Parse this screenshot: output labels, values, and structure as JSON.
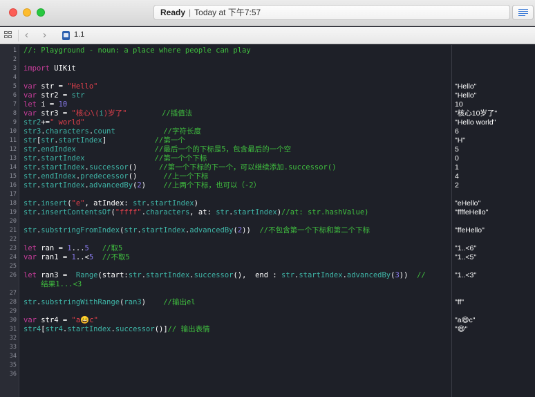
{
  "window": {
    "status": "Ready",
    "status_time": "Today at 下午7:57",
    "file_name": "1.1"
  },
  "icons": [
    "close-button",
    "minimize-button",
    "zoom-button",
    "editor-toggle-icon",
    "grid-icon",
    "back-chevron-icon",
    "forward-chevron-icon",
    "swift-file-icon"
  ],
  "colors": {
    "keyword": "#c83d9b",
    "string": "#e4404c",
    "number": "#8b7cf0",
    "comment": "#40bf3f",
    "api": "#3fb5a7",
    "background": "#1e2028"
  },
  "lines": [
    {
      "n": "1",
      "t": [
        {
          "c": "cm",
          "v": "//: Playground - noun: a place where people can play"
        }
      ],
      "r": ""
    },
    {
      "n": "2",
      "t": [],
      "r": ""
    },
    {
      "n": "3",
      "t": [
        {
          "c": "kw",
          "v": "import"
        },
        {
          "c": "pl",
          "v": " UIKit"
        }
      ],
      "r": ""
    },
    {
      "n": "4",
      "t": [],
      "r": ""
    },
    {
      "n": "5",
      "t": [
        {
          "c": "kw",
          "v": "var"
        },
        {
          "c": "pl",
          "v": " str = "
        },
        {
          "c": "str",
          "v": "\"Hello\""
        }
      ],
      "r": "\"Hello\""
    },
    {
      "n": "6",
      "t": [
        {
          "c": "kw",
          "v": "var"
        },
        {
          "c": "pl",
          "v": " str2 = "
        },
        {
          "c": "ap",
          "v": "str"
        }
      ],
      "r": "\"Hello\""
    },
    {
      "n": "7",
      "t": [
        {
          "c": "kw",
          "v": "let"
        },
        {
          "c": "pl",
          "v": " i = "
        },
        {
          "c": "num",
          "v": "10"
        }
      ],
      "r": "10"
    },
    {
      "n": "8",
      "t": [
        {
          "c": "kw",
          "v": "var"
        },
        {
          "c": "pl",
          "v": " str3 = "
        },
        {
          "c": "str",
          "v": "\"核心\\("
        },
        {
          "c": "ap",
          "v": "i"
        },
        {
          "c": "str",
          "v": ")岁了\""
        },
        {
          "c": "pl",
          "v": "        "
        },
        {
          "c": "cm",
          "v": "//插值法"
        }
      ],
      "r": "\"核心10岁了\""
    },
    {
      "n": "9",
      "t": [
        {
          "c": "ap",
          "v": "str2"
        },
        {
          "c": "pl",
          "v": "+="
        },
        {
          "c": "str",
          "v": "\" world\""
        }
      ],
      "r": "\"Hello world\""
    },
    {
      "n": "10",
      "t": [
        {
          "c": "ap",
          "v": "str3"
        },
        {
          "c": "pl",
          "v": "."
        },
        {
          "c": "ap",
          "v": "characters"
        },
        {
          "c": "pl",
          "v": "."
        },
        {
          "c": "ap",
          "v": "count"
        },
        {
          "c": "pl",
          "v": "           "
        },
        {
          "c": "cm",
          "v": "//字符长度"
        }
      ],
      "r": "6"
    },
    {
      "n": "11",
      "t": [
        {
          "c": "ap",
          "v": "str"
        },
        {
          "c": "pl",
          "v": "["
        },
        {
          "c": "ap",
          "v": "str"
        },
        {
          "c": "pl",
          "v": "."
        },
        {
          "c": "ap",
          "v": "startIndex"
        },
        {
          "c": "pl",
          "v": "]           "
        },
        {
          "c": "cm",
          "v": "//第一个"
        }
      ],
      "r": "\"H\""
    },
    {
      "n": "12",
      "t": [
        {
          "c": "ap",
          "v": "str"
        },
        {
          "c": "pl",
          "v": "."
        },
        {
          "c": "ap",
          "v": "endIndex"
        },
        {
          "c": "pl",
          "v": "                  "
        },
        {
          "c": "cm",
          "v": "//最后一个的下标是5，包含最后的一个空"
        }
      ],
      "r": "5"
    },
    {
      "n": "13",
      "t": [
        {
          "c": "ap",
          "v": "str"
        },
        {
          "c": "pl",
          "v": "."
        },
        {
          "c": "ap",
          "v": "startIndex"
        },
        {
          "c": "pl",
          "v": "                "
        },
        {
          "c": "cm",
          "v": "//第一个个下标"
        }
      ],
      "r": "0"
    },
    {
      "n": "14",
      "t": [
        {
          "c": "ap",
          "v": "str"
        },
        {
          "c": "pl",
          "v": "."
        },
        {
          "c": "ap",
          "v": "startIndex"
        },
        {
          "c": "pl",
          "v": "."
        },
        {
          "c": "ap",
          "v": "successor"
        },
        {
          "c": "pl",
          "v": "()     "
        },
        {
          "c": "cm",
          "v": "//第一个下标的下一个，可以继续添加.successor()"
        }
      ],
      "r": "1"
    },
    {
      "n": "15",
      "t": [
        {
          "c": "ap",
          "v": "str"
        },
        {
          "c": "pl",
          "v": "."
        },
        {
          "c": "ap",
          "v": "endIndex"
        },
        {
          "c": "pl",
          "v": "."
        },
        {
          "c": "ap",
          "v": "predecessor"
        },
        {
          "c": "pl",
          "v": "()      "
        },
        {
          "c": "cm",
          "v": "//上一个下标"
        }
      ],
      "r": "4"
    },
    {
      "n": "16",
      "t": [
        {
          "c": "ap",
          "v": "str"
        },
        {
          "c": "pl",
          "v": "."
        },
        {
          "c": "ap",
          "v": "startIndex"
        },
        {
          "c": "pl",
          "v": "."
        },
        {
          "c": "ap",
          "v": "advancedBy"
        },
        {
          "c": "pl",
          "v": "("
        },
        {
          "c": "num",
          "v": "2"
        },
        {
          "c": "pl",
          "v": ")    "
        },
        {
          "c": "cm",
          "v": "//上两个下标，也可以（-2）"
        }
      ],
      "r": "2"
    },
    {
      "n": "17",
      "t": [],
      "r": ""
    },
    {
      "n": "18",
      "t": [
        {
          "c": "ap",
          "v": "str"
        },
        {
          "c": "pl",
          "v": "."
        },
        {
          "c": "ap",
          "v": "insert"
        },
        {
          "c": "pl",
          "v": "("
        },
        {
          "c": "str",
          "v": "\"e\""
        },
        {
          "c": "pl",
          "v": ", atIndex: "
        },
        {
          "c": "ap",
          "v": "str"
        },
        {
          "c": "pl",
          "v": "."
        },
        {
          "c": "ap",
          "v": "startIndex"
        },
        {
          "c": "pl",
          "v": ")"
        }
      ],
      "r": "\"eHello\""
    },
    {
      "n": "19",
      "t": [
        {
          "c": "ap",
          "v": "str"
        },
        {
          "c": "pl",
          "v": "."
        },
        {
          "c": "ap",
          "v": "insertContentsOf"
        },
        {
          "c": "pl",
          "v": "("
        },
        {
          "c": "str",
          "v": "\"ffff\""
        },
        {
          "c": "pl",
          "v": "."
        },
        {
          "c": "ap",
          "v": "characters"
        },
        {
          "c": "pl",
          "v": ", at: "
        },
        {
          "c": "ap",
          "v": "str"
        },
        {
          "c": "pl",
          "v": "."
        },
        {
          "c": "ap",
          "v": "startIndex"
        },
        {
          "c": "pl",
          "v": ")"
        },
        {
          "c": "cm",
          "v": "//at: str.hashValue)"
        }
      ],
      "r": "\"ffffeHello\""
    },
    {
      "n": "20",
      "t": [],
      "r": ""
    },
    {
      "n": "21",
      "t": [
        {
          "c": "ap",
          "v": "str"
        },
        {
          "c": "pl",
          "v": "."
        },
        {
          "c": "ap",
          "v": "substringFromIndex"
        },
        {
          "c": "pl",
          "v": "("
        },
        {
          "c": "ap",
          "v": "str"
        },
        {
          "c": "pl",
          "v": "."
        },
        {
          "c": "ap",
          "v": "startIndex"
        },
        {
          "c": "pl",
          "v": "."
        },
        {
          "c": "ap",
          "v": "advancedBy"
        },
        {
          "c": "pl",
          "v": "("
        },
        {
          "c": "num",
          "v": "2"
        },
        {
          "c": "pl",
          "v": "))  "
        },
        {
          "c": "cm",
          "v": "//不包含第一个下标和第二个下标"
        }
      ],
      "r": "\"ffeHello\""
    },
    {
      "n": "22",
      "t": [],
      "r": ""
    },
    {
      "n": "23",
      "t": [
        {
          "c": "kw",
          "v": "let"
        },
        {
          "c": "pl",
          "v": " ran = "
        },
        {
          "c": "num",
          "v": "1"
        },
        {
          "c": "pl",
          "v": "..."
        },
        {
          "c": "num",
          "v": "5"
        },
        {
          "c": "pl",
          "v": "   "
        },
        {
          "c": "cm",
          "v": "//取5"
        }
      ],
      "r": "\"1..<6\""
    },
    {
      "n": "24",
      "t": [
        {
          "c": "kw",
          "v": "var"
        },
        {
          "c": "pl",
          "v": " ran1 = "
        },
        {
          "c": "num",
          "v": "1"
        },
        {
          "c": "pl",
          "v": "..<"
        },
        {
          "c": "num",
          "v": "5"
        },
        {
          "c": "pl",
          "v": "  "
        },
        {
          "c": "cm",
          "v": "//不取5"
        }
      ],
      "r": "\"1..<5\""
    },
    {
      "n": "25",
      "t": [],
      "r": ""
    },
    {
      "n": "26",
      "t": [
        {
          "c": "kw",
          "v": "let"
        },
        {
          "c": "pl",
          "v": " ran3 =  "
        },
        {
          "c": "ap",
          "v": "Range"
        },
        {
          "c": "pl",
          "v": "(start:"
        },
        {
          "c": "ap",
          "v": "str"
        },
        {
          "c": "pl",
          "v": "."
        },
        {
          "c": "ap",
          "v": "startIndex"
        },
        {
          "c": "pl",
          "v": "."
        },
        {
          "c": "ap",
          "v": "successor"
        },
        {
          "c": "pl",
          "v": "(),  end : "
        },
        {
          "c": "ap",
          "v": "str"
        },
        {
          "c": "pl",
          "v": "."
        },
        {
          "c": "ap",
          "v": "startIndex"
        },
        {
          "c": "pl",
          "v": "."
        },
        {
          "c": "ap",
          "v": "advancedBy"
        },
        {
          "c": "pl",
          "v": "("
        },
        {
          "c": "num",
          "v": "3"
        },
        {
          "c": "pl",
          "v": "))  "
        },
        {
          "c": "cm",
          "v": "//"
        }
      ],
      "r": "\"1..<3\""
    },
    {
      "n": "",
      "t": [
        {
          "c": "pl",
          "v": "    "
        },
        {
          "c": "cm",
          "v": "结果1...<3"
        }
      ],
      "r": ""
    },
    {
      "n": "27",
      "t": [],
      "r": ""
    },
    {
      "n": "28",
      "t": [
        {
          "c": "ap",
          "v": "str"
        },
        {
          "c": "pl",
          "v": "."
        },
        {
          "c": "ap",
          "v": "substringWithRange"
        },
        {
          "c": "pl",
          "v": "("
        },
        {
          "c": "ap",
          "v": "ran3"
        },
        {
          "c": "pl",
          "v": ")    "
        },
        {
          "c": "cm",
          "v": "//输出el"
        }
      ],
      "r": "\"ff\""
    },
    {
      "n": "29",
      "t": [],
      "r": ""
    },
    {
      "n": "30",
      "t": [
        {
          "c": "kw",
          "v": "var"
        },
        {
          "c": "pl",
          "v": " str4 = "
        },
        {
          "c": "str",
          "v": "\"a😄c\""
        }
      ],
      "r": "\"a😄c\""
    },
    {
      "n": "31",
      "t": [
        {
          "c": "ap",
          "v": "str4"
        },
        {
          "c": "pl",
          "v": "["
        },
        {
          "c": "ap",
          "v": "str4"
        },
        {
          "c": "pl",
          "v": "."
        },
        {
          "c": "ap",
          "v": "startIndex"
        },
        {
          "c": "pl",
          "v": "."
        },
        {
          "c": "ap",
          "v": "successor"
        },
        {
          "c": "pl",
          "v": "()]"
        },
        {
          "c": "cm",
          "v": "// 输出表情"
        }
      ],
      "r": "\"😄\""
    },
    {
      "n": "32",
      "t": [],
      "r": ""
    },
    {
      "n": "33",
      "t": [],
      "r": ""
    },
    {
      "n": "34",
      "t": [],
      "r": ""
    },
    {
      "n": "35",
      "t": [],
      "r": ""
    },
    {
      "n": "36",
      "t": [],
      "r": ""
    }
  ]
}
